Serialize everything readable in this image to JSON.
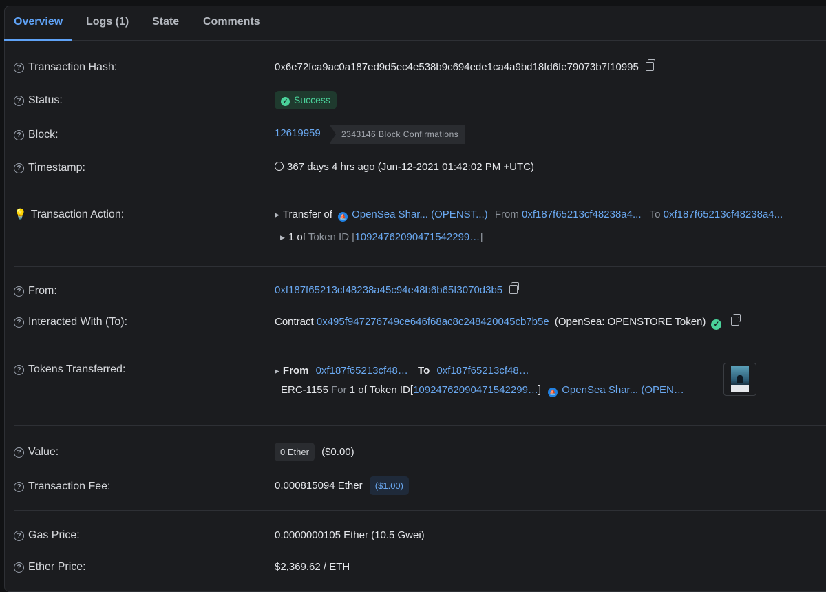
{
  "tabs": [
    {
      "label": "Overview"
    },
    {
      "label": "Logs (1)"
    },
    {
      "label": "State"
    },
    {
      "label": "Comments"
    }
  ],
  "rows": {
    "tx_hash": {
      "label": "Transaction Hash:",
      "value": "0x6e72fca9ac0a187ed9d5ec4e538b9c694ede1ca4a9bd18fd6fe79073b7f10995"
    },
    "status": {
      "label": "Status:",
      "value": "Success"
    },
    "block": {
      "label": "Block:",
      "number": "12619959",
      "confirmations": "2343146 Block Confirmations"
    },
    "timestamp": {
      "label": "Timestamp:",
      "value": "367 days 4 hrs ago (Jun-12-2021 01:42:02 PM +UTC)"
    },
    "action": {
      "label": "Transaction Action:",
      "transfer_of": "Transfer of",
      "token_name": "OpenSea Shar... (OPENST...)",
      "from_word": "From",
      "from_addr": "0xf187f65213cf48238a4...",
      "to_word": "To",
      "to_addr": "0xf187f65213cf48238a4...",
      "qty": "1 of",
      "token_id_word": "Token ID",
      "token_id": "10924762090471542299…"
    },
    "from": {
      "label": "From:",
      "value": "0xf187f65213cf48238a45c94e48b6b65f3070d3b5"
    },
    "interacted": {
      "label": "Interacted With (To):",
      "prefix": "Contract",
      "address": "0x495f947276749ce646f68ac8c248420045cb7b5e",
      "name": "(OpenSea: OPENSTORE Token)"
    },
    "tokens": {
      "label": "Tokens Transferred:",
      "from_word": "From",
      "from_addr": "0xf187f65213cf48…",
      "to_word": "To",
      "to_addr": "0xf187f65213cf48…",
      "standard": "ERC-1155",
      "for_word": "For",
      "qty_text": "1 of Token ID",
      "token_id": "10924762090471542299…",
      "token_name": "OpenSea Shar... (OPEN…"
    },
    "value": {
      "label": "Value:",
      "amount": "0 Ether",
      "usd": "($0.00)"
    },
    "fee": {
      "label": "Transaction Fee:",
      "amount": "0.000815094 Ether",
      "usd": "($1.00)"
    },
    "gas_price": {
      "label": "Gas Price:",
      "value": "0.0000000105 Ether (10.5 Gwei)"
    },
    "ether_price": {
      "label": "Ether Price:",
      "value": "$2,369.62 / ETH"
    }
  }
}
